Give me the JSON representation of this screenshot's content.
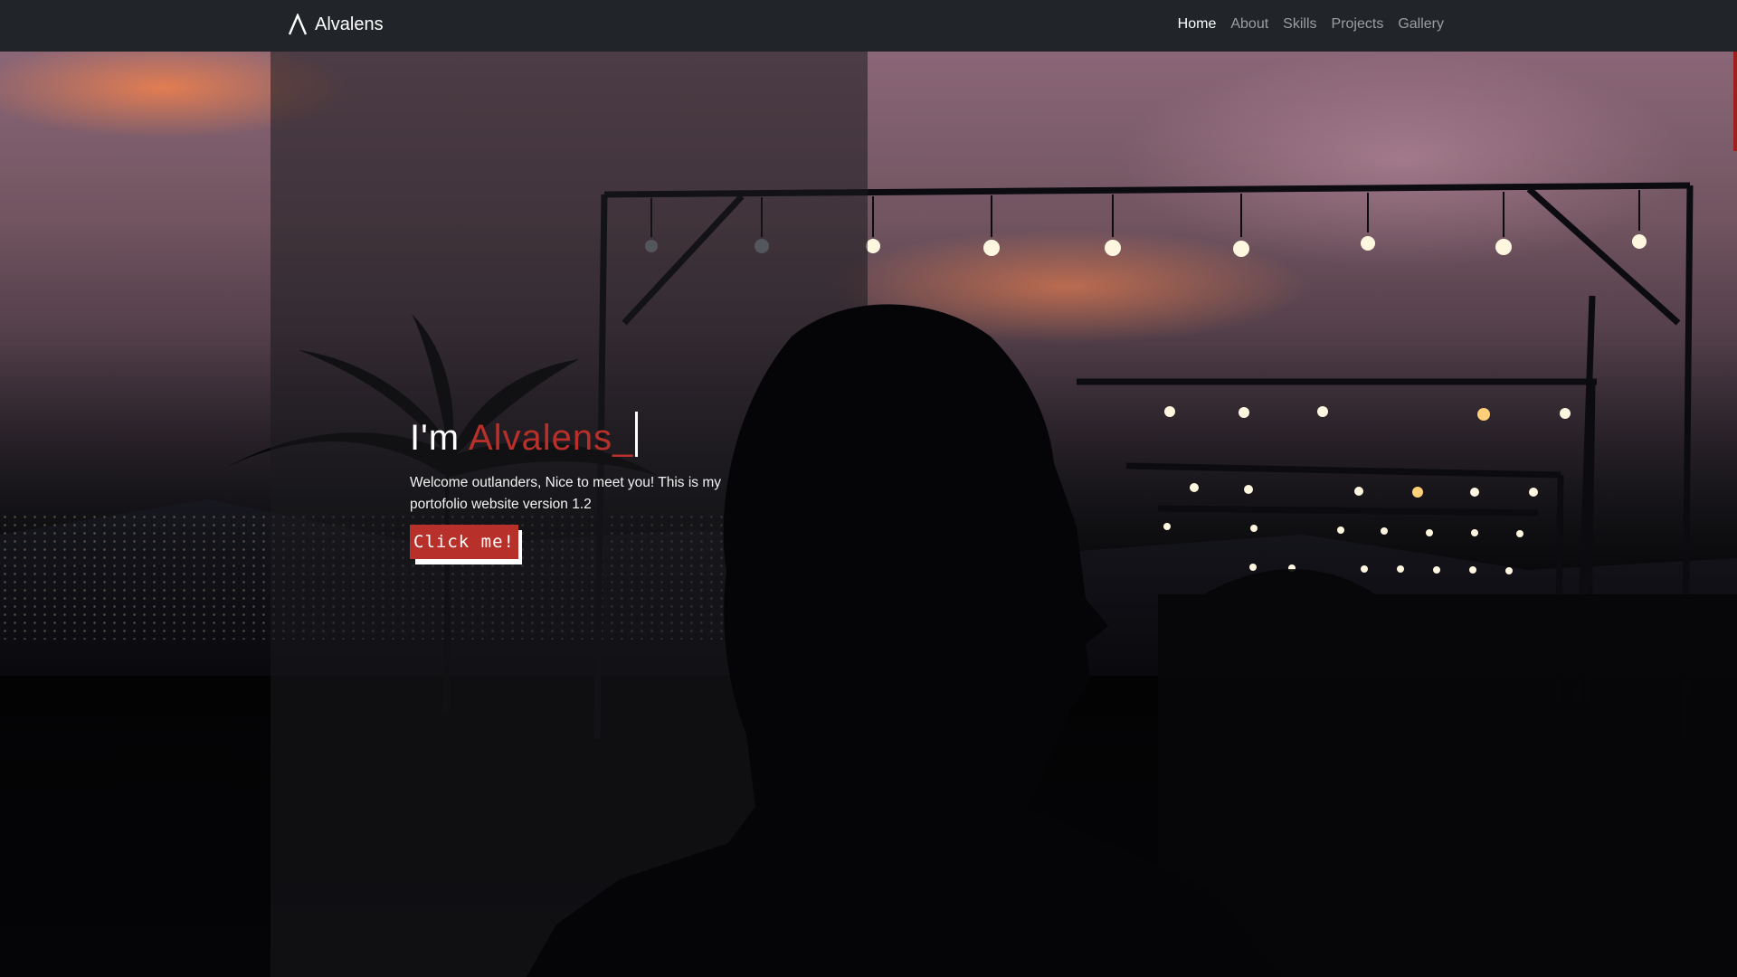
{
  "nav": {
    "brand_name": "Alvalens",
    "brand_icon": "lambda-logo-icon",
    "links": [
      {
        "label": "Home",
        "active": true
      },
      {
        "label": "About",
        "active": false
      },
      {
        "label": "Skills",
        "active": false
      },
      {
        "label": "Projects",
        "active": false
      },
      {
        "label": "Gallery",
        "active": false
      }
    ]
  },
  "hero": {
    "greeting": "I'm",
    "name": "Alvalens_",
    "description": "Welcome outlanders, Nice to meet you! This is my portofolio website version 1.2",
    "cta_label": "Click me!",
    "background": "photo-silhouette-rooftop-string-lights"
  },
  "colors": {
    "navbar": "#212529",
    "accent": "#b8302a",
    "text": "#ffffff"
  }
}
